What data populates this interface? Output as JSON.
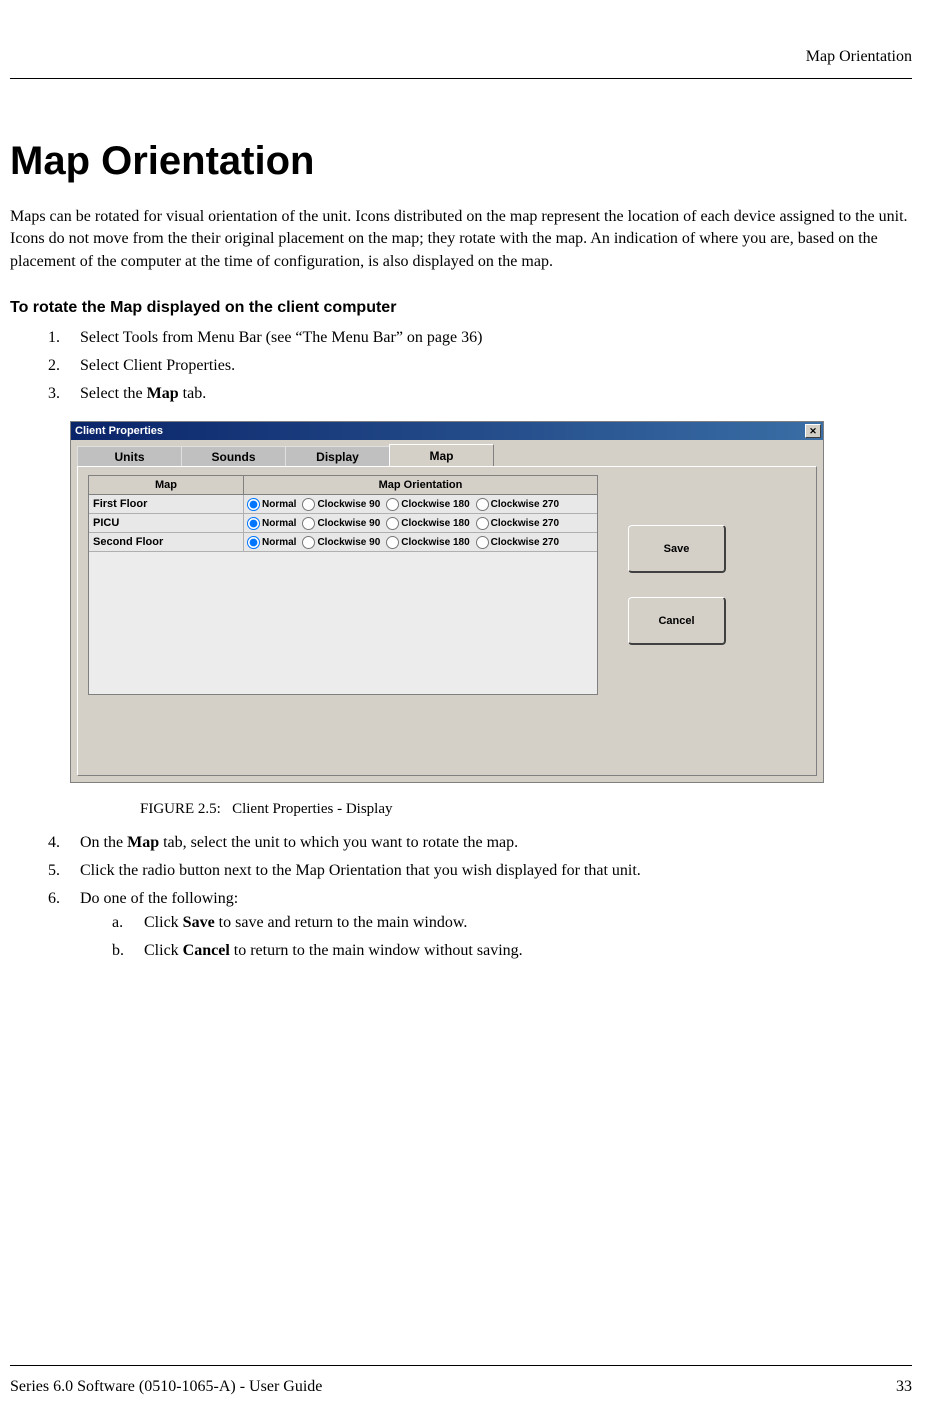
{
  "header": {
    "running": "Map Orientation"
  },
  "title": "Map Orientation",
  "intro": "Maps can be rotated for visual orientation of the unit. Icons distributed on the map represent the location of each device assigned to the unit. Icons do not move from the their original placement on the map; they rotate with the map. An indication of where you are, based on the placement of the computer at the time of configuration, is also displayed on the map.",
  "subhead": "To rotate the Map displayed on the client computer",
  "steps": {
    "s1": "Select Tools from Menu Bar (see “The Menu Bar” on page 36)",
    "s2": "Select Client Properties.",
    "s3_pre": "Select the ",
    "s3_bold": "Map",
    "s3_post": " tab.",
    "s4_pre": "On the ",
    "s4_bold": "Map",
    "s4_post": " tab, select the unit to which you want to rotate the map.",
    "s5": "Click the radio button next to the Map Orientation that you wish displayed for that unit.",
    "s6": "Do one of the following:",
    "s6a_pre": "Click ",
    "s6a_bold": "Save",
    "s6a_post": " to save and return to the main window.",
    "s6b_pre": "Click ",
    "s6b_bold": "Cancel",
    "s6b_post": " to return to the main window without saving."
  },
  "figure": {
    "caption_label": "FIGURE 2.5:",
    "caption_text": "Client Properties - Display",
    "window_title": "Client Properties",
    "tabs": {
      "units": "Units",
      "sounds": "Sounds",
      "display": "Display",
      "map": "Map"
    },
    "columns": {
      "map": "Map",
      "orient": "Map Orientation"
    },
    "rows": [
      {
        "name": "First Floor"
      },
      {
        "name": "PICU"
      },
      {
        "name": "Second Floor"
      }
    ],
    "options": {
      "normal": "Normal",
      "c90": "Clockwise 90",
      "c180": "Clockwise 180",
      "c270": "Clockwise 270"
    },
    "buttons": {
      "save": "Save",
      "cancel": "Cancel"
    }
  },
  "footer": {
    "left": "Series 6.0 Software (0510-1065-A) - User Guide",
    "right": "33"
  }
}
